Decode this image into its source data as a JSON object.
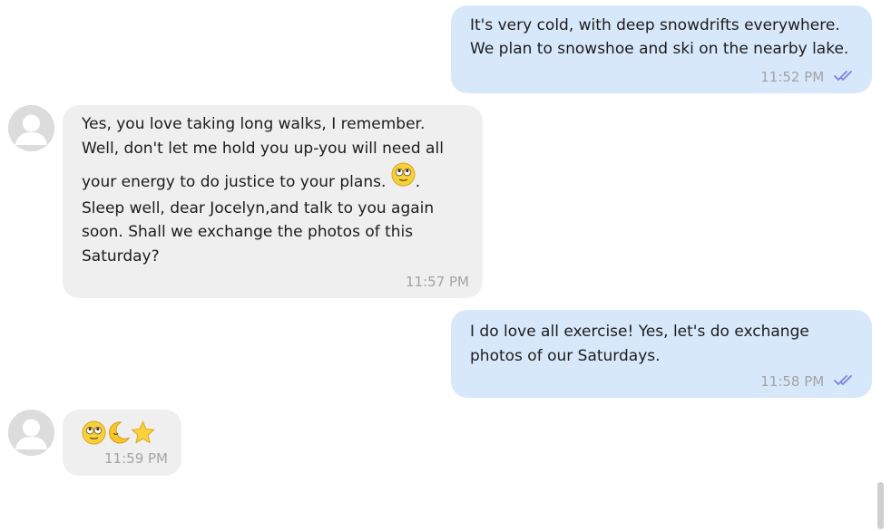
{
  "messages": [
    {
      "direction": "outgoing",
      "lines": [
        "It's very cold, with deep snowdrifts everywhere.",
        "We plan to snowshoe and ski on the nearby lake."
      ],
      "time": "11:52 PM",
      "status_icon": "double-check-icon"
    },
    {
      "direction": "incoming",
      "avatar_icon": "user-silhouette-icon",
      "lines": [
        "Yes, you love taking long walks, I remember.",
        "Well, don't let me hold you up-you will need all",
        "your energy to do justice to your plans.",
        "Sleep well, dear Jocelyn,and talk to you again",
        "soon. Shall we exchange the photos of this",
        "Saturday?"
      ],
      "line3_suffix": ".",
      "inline_emoji": "rolling-eyes-smiley-icon",
      "time": "11:57 PM"
    },
    {
      "direction": "outgoing",
      "lines": [
        "I do love all exercise! Yes, let's do exchange",
        "photos of our Saturdays."
      ],
      "time": "11:58 PM",
      "status_icon": "double-check-icon"
    },
    {
      "direction": "incoming",
      "avatar_icon": "user-silhouette-icon",
      "emojis": [
        "rolling-eyes-smiley-icon",
        "crescent-moon-icon",
        "star-icon"
      ],
      "time": "11:59 PM"
    }
  ],
  "colors": {
    "outgoing_bubble": "#d8e8fb",
    "incoming_bubble": "#efefef",
    "timestamp": "#a3a3a3",
    "read_ticks": "#7b83d9"
  }
}
